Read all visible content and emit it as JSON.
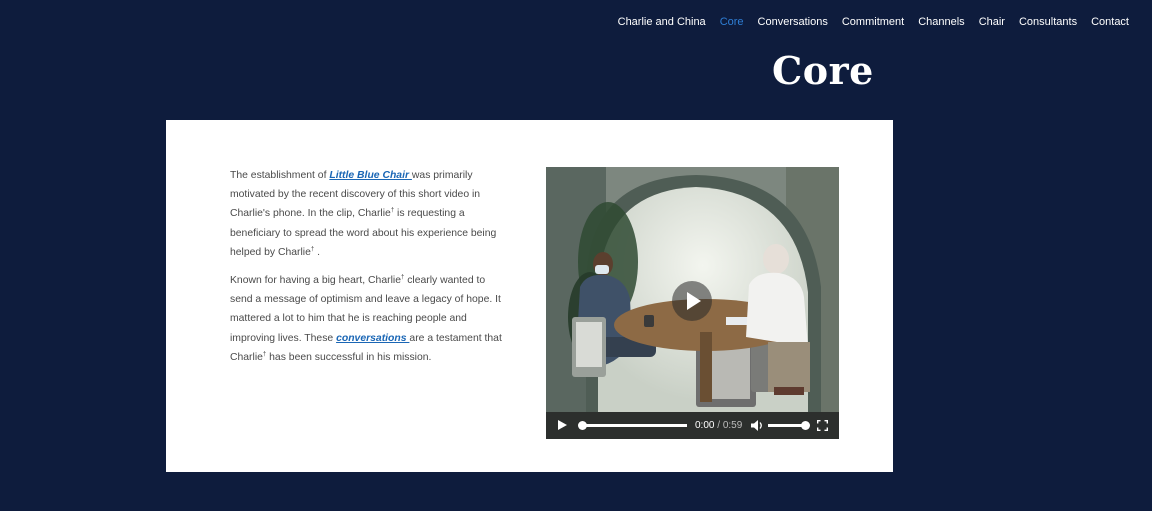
{
  "nav": {
    "items": [
      {
        "label": "Charlie and China",
        "active": false
      },
      {
        "label": "Core",
        "active": true
      },
      {
        "label": "Conversations",
        "active": false
      },
      {
        "label": "Commitment",
        "active": false
      },
      {
        "label": "Channels",
        "active": false
      },
      {
        "label": "Chair",
        "active": false
      },
      {
        "label": "Consultants",
        "active": false
      },
      {
        "label": "Contact",
        "active": false
      }
    ],
    "active_color": "#2f7fd6"
  },
  "page": {
    "title": "Core",
    "background_color": "#0e1c3d"
  },
  "content": {
    "paragraph1": {
      "before_link": "The establishment of ",
      "link": "Little Blue Chair ",
      "after_link": "was primarily motivated by the recent discovery of this short video in Charlie's phone. In the clip, Charlie",
      "mark1": "†",
      "middle": " is requesting a beneficiary to spread the word about his experience being helped by Charlie",
      "mark2": "†",
      "end": " ."
    },
    "paragraph2": {
      "start": "Known for having a big heart, Charlie",
      "mark1": "†",
      "middle": "  clearly wanted to send a message of optimism and leave a legacy of hope. It mattered a lot to him that he is reaching people and improving lives. These ",
      "link": "conversations ",
      "after_link": "are a testament that Charlie",
      "mark2": "†",
      "end": "  has been successful in his mission."
    },
    "link_color": "#1a66b5"
  },
  "video": {
    "current_time": "0:00",
    "separator": " / ",
    "duration": "0:59",
    "progress_fraction": 0.0,
    "volume_fraction": 1.0,
    "icons": {
      "big_play": "play-icon",
      "play": "play-icon",
      "mute": "volume-icon",
      "fullscreen": "fullscreen-icon"
    }
  }
}
